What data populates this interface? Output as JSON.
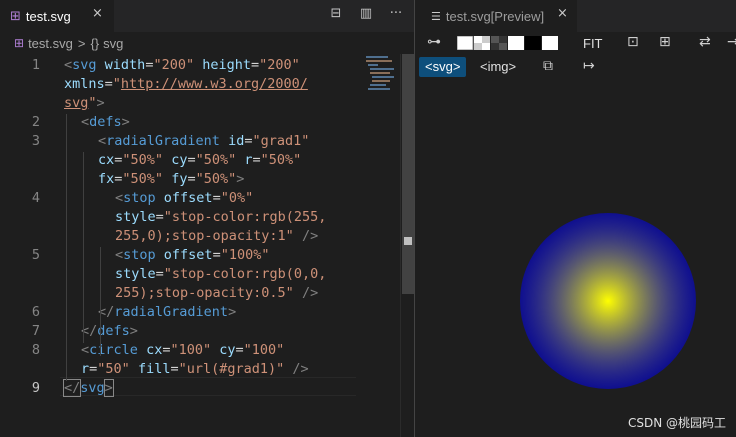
{
  "editor": {
    "tab": {
      "icon": "svg-file-icon",
      "label": "test.svg",
      "close": "×"
    },
    "actions": [
      "⊟",
      "▥",
      "···"
    ],
    "breadcrumbs": {
      "file": "test.svg",
      "separator": ">",
      "symbol_icon": "{}",
      "symbol": "svg"
    }
  },
  "code_lines": [
    {
      "num": "1",
      "segments": [
        [
          "t-pun",
          "<"
        ],
        [
          "t-tag",
          "svg"
        ],
        [
          "t-txt",
          " "
        ],
        [
          "t-attr",
          "width"
        ],
        [
          "t-txt",
          "="
        ],
        [
          "t-str",
          "\"200\""
        ],
        [
          "t-txt",
          " "
        ],
        [
          "t-attr",
          "height"
        ],
        [
          "t-txt",
          "="
        ],
        [
          "t-str",
          "\"200\""
        ]
      ]
    },
    {
      "num": "",
      "segments": [
        [
          "t-attr",
          "xmlns"
        ],
        [
          "t-txt",
          "="
        ],
        [
          "t-str",
          "\""
        ],
        [
          "t-link",
          "http://www.w3.org/2000/"
        ]
      ]
    },
    {
      "num": "",
      "segments": [
        [
          "t-link",
          "svg"
        ],
        [
          "t-str",
          "\""
        ],
        [
          "t-pun",
          ">"
        ]
      ]
    },
    {
      "num": "2",
      "segments": [
        [
          "t-pun",
          "<"
        ],
        [
          "t-tag",
          "defs"
        ],
        [
          "t-pun",
          ">"
        ]
      ]
    },
    {
      "num": "3",
      "segments": [
        [
          "t-pun",
          "<"
        ],
        [
          "t-tag",
          "radialGradient"
        ],
        [
          "t-txt",
          " "
        ],
        [
          "t-attr",
          "id"
        ],
        [
          "t-txt",
          "="
        ],
        [
          "t-str",
          "\"grad1\""
        ]
      ]
    },
    {
      "num": "",
      "segments": [
        [
          "t-attr",
          "cx"
        ],
        [
          "t-txt",
          "="
        ],
        [
          "t-str",
          "\"50%\""
        ],
        [
          "t-txt",
          " "
        ],
        [
          "t-attr",
          "cy"
        ],
        [
          "t-txt",
          "="
        ],
        [
          "t-str",
          "\"50%\""
        ],
        [
          "t-txt",
          " "
        ],
        [
          "t-attr",
          "r"
        ],
        [
          "t-txt",
          "="
        ],
        [
          "t-str",
          "\"50%\""
        ]
      ]
    },
    {
      "num": "",
      "segments": [
        [
          "t-attr",
          "fx"
        ],
        [
          "t-txt",
          "="
        ],
        [
          "t-str",
          "\"50%\""
        ],
        [
          "t-txt",
          " "
        ],
        [
          "t-attr",
          "fy"
        ],
        [
          "t-txt",
          "="
        ],
        [
          "t-str",
          "\"50%\""
        ],
        [
          "t-pun",
          ">"
        ]
      ]
    },
    {
      "num": "4",
      "segments": [
        [
          "t-pun",
          "<"
        ],
        [
          "t-tag",
          "stop"
        ],
        [
          "t-txt",
          " "
        ],
        [
          "t-attr",
          "offset"
        ],
        [
          "t-txt",
          "="
        ],
        [
          "t-str",
          "\"0%\""
        ]
      ]
    },
    {
      "num": "",
      "segments": [
        [
          "t-attr",
          "style"
        ],
        [
          "t-txt",
          "="
        ],
        [
          "t-str",
          "\"stop-color:rgb(255,"
        ]
      ]
    },
    {
      "num": "",
      "segments": [
        [
          "t-str",
          "255,0);stop-opacity:1\""
        ],
        [
          "t-txt",
          " "
        ],
        [
          "t-pun",
          "/>"
        ]
      ]
    },
    {
      "num": "5",
      "segments": [
        [
          "t-pun",
          "<"
        ],
        [
          "t-tag",
          "stop"
        ],
        [
          "t-txt",
          " "
        ],
        [
          "t-attr",
          "offset"
        ],
        [
          "t-txt",
          "="
        ],
        [
          "t-str",
          "\"100%\""
        ]
      ]
    },
    {
      "num": "",
      "segments": [
        [
          "t-attr",
          "style"
        ],
        [
          "t-txt",
          "="
        ],
        [
          "t-str",
          "\"stop-color:rgb(0,0,"
        ]
      ]
    },
    {
      "num": "",
      "segments": [
        [
          "t-str",
          "255);stop-opacity:0.5\""
        ],
        [
          "t-txt",
          " "
        ],
        [
          "t-pun",
          "/>"
        ]
      ]
    },
    {
      "num": "6",
      "segments": [
        [
          "t-pun",
          "</"
        ],
        [
          "t-tag",
          "radialGradient"
        ],
        [
          "t-pun",
          ">"
        ]
      ]
    },
    {
      "num": "7",
      "segments": [
        [
          "t-pun",
          "</"
        ],
        [
          "t-tag",
          "defs"
        ],
        [
          "t-pun",
          ">"
        ]
      ]
    },
    {
      "num": "8",
      "segments": [
        [
          "t-pun",
          "<"
        ],
        [
          "t-tag",
          "circle"
        ],
        [
          "t-txt",
          " "
        ],
        [
          "t-attr",
          "cx"
        ],
        [
          "t-txt",
          "="
        ],
        [
          "t-str",
          "\"100\""
        ],
        [
          "t-txt",
          " "
        ],
        [
          "t-attr",
          "cy"
        ],
        [
          "t-txt",
          "="
        ],
        [
          "t-str",
          "\"100\""
        ]
      ]
    },
    {
      "num": "",
      "segments": [
        [
          "t-attr",
          "r"
        ],
        [
          "t-txt",
          "="
        ],
        [
          "t-str",
          "\"50\""
        ],
        [
          "t-txt",
          " "
        ],
        [
          "t-attr",
          "fill"
        ],
        [
          "t-txt",
          "="
        ],
        [
          "t-str",
          "\"url(#grad1)\""
        ],
        [
          "t-txt",
          " "
        ],
        [
          "t-pun",
          "/>"
        ]
      ]
    },
    {
      "num": "9",
      "segments": [
        [
          "t-pun",
          "</"
        ],
        [
          "t-tag",
          "svg"
        ],
        [
          "t-pun",
          ">"
        ]
      ]
    }
  ],
  "preview": {
    "tab": {
      "icon": "preview-icon",
      "label": "test.svg[Preview]",
      "close": "×"
    },
    "toolbar": {
      "pin_icon": "⊶",
      "fit": "FIT",
      "icons": [
        "⊡",
        "⊞",
        "⇄",
        "→"
      ]
    },
    "view_tabs": [
      "<svg>",
      "<img>"
    ],
    "copy_icon": "⧉",
    "arrow_icon": "↦",
    "gradient": {
      "inner": "#ffff00",
      "outer": "#0000ff",
      "outer_opacity": 0.5
    }
  },
  "watermark": "CSDN @桃园码工"
}
